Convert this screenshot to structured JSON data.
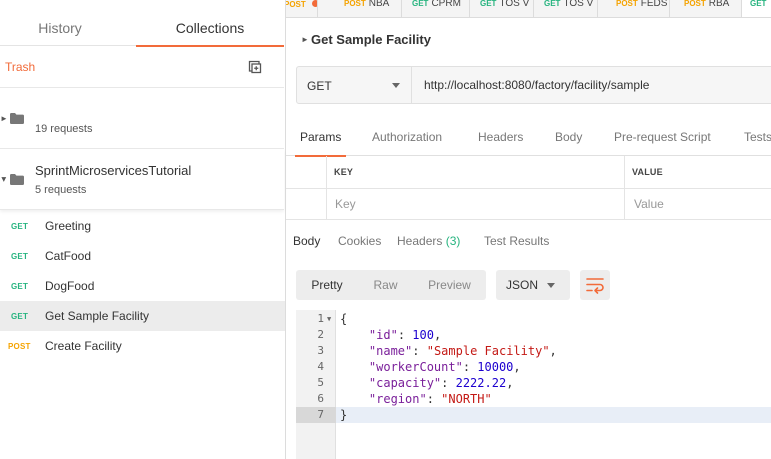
{
  "sidebar": {
    "tabs": [
      "History",
      "Collections"
    ],
    "active_tab": "Collections",
    "trash_label": "Trash",
    "collections": [
      {
        "name": "",
        "count": "19 requests"
      },
      {
        "name": "SprintMicroservicesTutorial",
        "count": "5 requests"
      }
    ],
    "requests": [
      {
        "method": "GET",
        "name": "Greeting"
      },
      {
        "method": "GET",
        "name": "CatFood"
      },
      {
        "method": "GET",
        "name": "DogFood"
      },
      {
        "method": "GET",
        "name": "Get Sample Facility"
      },
      {
        "method": "POST",
        "name": "Create Facility"
      }
    ]
  },
  "top_tabs": [
    {
      "method": "POST",
      "label": ""
    },
    {
      "method": "POST",
      "label": "NBA"
    },
    {
      "method": "GET",
      "label": "CPRM"
    },
    {
      "method": "GET",
      "label": "TOS V"
    },
    {
      "method": "GET",
      "label": "TOS V"
    },
    {
      "method": "POST",
      "label": "FEDS"
    },
    {
      "method": "POST",
      "label": "RBA"
    },
    {
      "method": "GET",
      "label": ""
    }
  ],
  "request": {
    "title": "Get Sample Facility",
    "method": "GET",
    "url": "http://localhost:8080/factory/facility/sample"
  },
  "request_tabs": [
    "Params",
    "Authorization",
    "Headers",
    "Body",
    "Pre-request Script",
    "Tests"
  ],
  "active_request_tab": "Params",
  "params": {
    "key_header": "KEY",
    "value_header": "VALUE",
    "key_placeholder": "Key",
    "value_placeholder": "Value"
  },
  "response_tabs": {
    "body": "Body",
    "cookies": "Cookies",
    "headers": "Headers",
    "headers_count": "(3)",
    "test_results": "Test Results"
  },
  "response_toolbar": {
    "formats": [
      "Pretty",
      "Raw",
      "Preview"
    ],
    "active_format": "Pretty",
    "language": "JSON"
  },
  "response_body": {
    "line_numbers": [
      "1",
      "2",
      "3",
      "4",
      "5",
      "6",
      "7"
    ],
    "open_brace": "{",
    "close_brace": "}",
    "fields": [
      {
        "key": "\"id\"",
        "value": "100",
        "type": "number",
        "comma": ","
      },
      {
        "key": "\"name\"",
        "value": "\"Sample Facility\"",
        "type": "string",
        "comma": ","
      },
      {
        "key": "\"workerCount\"",
        "value": "10000",
        "type": "number",
        "comma": ","
      },
      {
        "key": "\"capacity\"",
        "value": "2222.22",
        "type": "number",
        "comma": ","
      },
      {
        "key": "\"region\"",
        "value": "\"NORTH\"",
        "type": "string",
        "comma": ""
      }
    ]
  },
  "colors": {
    "accent": "#f26b3a",
    "get": "#26b47f",
    "post": "#f5a300",
    "json_key": "#7a1f9a",
    "json_string": "#c41a16",
    "json_number": "#1c00cf"
  }
}
